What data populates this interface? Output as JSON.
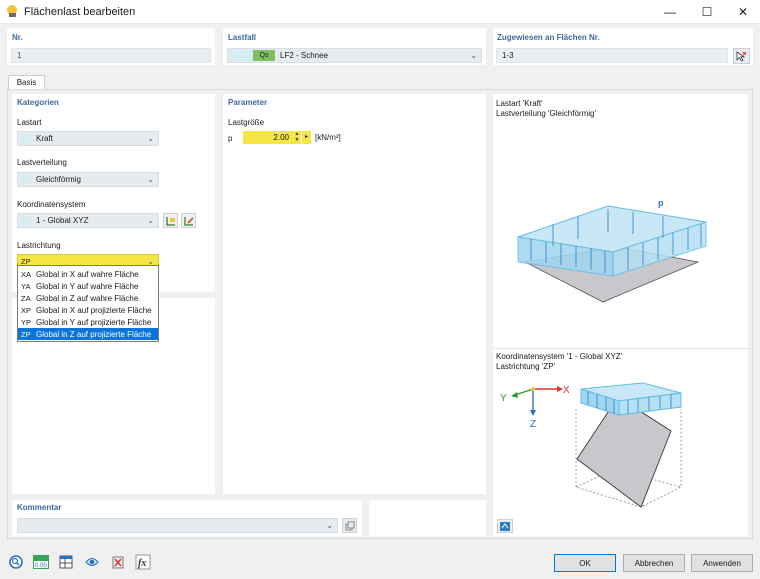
{
  "window": {
    "title": "Flächenlast bearbeiten",
    "minimize": "—",
    "maximize": "☐",
    "close": "✕"
  },
  "header": {
    "nr": {
      "label": "Nr.",
      "value": "1"
    },
    "lastfall": {
      "label": "Lastfall",
      "badge": "Qs",
      "value": "LF2 - Schnee",
      "badge_color": "#7fbf5f"
    },
    "zugewiesen": {
      "label": "Zugewiesen an Flächen Nr.",
      "value": "1-3"
    }
  },
  "tabs": [
    {
      "label": "Basis"
    }
  ],
  "kategorien": {
    "title": "Kategorien",
    "lastart": {
      "label": "Lastart",
      "value": "Kraft"
    },
    "lastverteilung": {
      "label": "Lastverteilung",
      "value": "Gleichförmig"
    },
    "koordinatensystem": {
      "label": "Koordinatensystem",
      "value": "1 - Global XYZ"
    },
    "lastrichtung": {
      "label": "Lastrichtung",
      "value": "ZP"
    }
  },
  "dropdown": {
    "items": [
      {
        "code": "XA",
        "label": "Global in X auf wahre Fläche"
      },
      {
        "code": "YA",
        "label": "Global in Y auf wahre Fläche"
      },
      {
        "code": "ZA",
        "label": "Global in Z auf wahre Fläche"
      },
      {
        "code": "XP",
        "label": "Global in X auf projizierte Fläche"
      },
      {
        "code": "YP",
        "label": "Global in Y auf projizierte Fläche"
      },
      {
        "code": "ZP",
        "label": "Global in Z auf projizierte Fläche"
      }
    ],
    "selected_index": 5
  },
  "parameter": {
    "title": "Parameter",
    "lastgroesse_label": "Lastgröße",
    "p_label": "p",
    "p_value": "2.00",
    "unit": "[kN/m²]"
  },
  "preview": {
    "top_line1": "Lastart 'Kraft'",
    "top_line2": "Lastverteilung 'Gleichförmig'",
    "p_symbol": "p",
    "bottom_line1": "Koordinatensystem '1 - Global XYZ'",
    "bottom_line2": "Lastrichtung 'ZP'",
    "axis_x": "X",
    "axis_y": "Y",
    "axis_z": "Z"
  },
  "kommentar": {
    "title": "Kommentar",
    "value": ""
  },
  "buttons": {
    "ok": "OK",
    "cancel": "Abbrechen",
    "apply": "Anwenden"
  },
  "bottom_tools": [
    "search-icon",
    "numeric-0-00-icon",
    "load-table-icon",
    "display-icon",
    "delete-icon",
    "formula-icon"
  ],
  "colors": {
    "accent": "#3c6a9c",
    "highlight": "#f5e645",
    "selection": "#0a74da",
    "load_blue": "#5fbde6"
  }
}
